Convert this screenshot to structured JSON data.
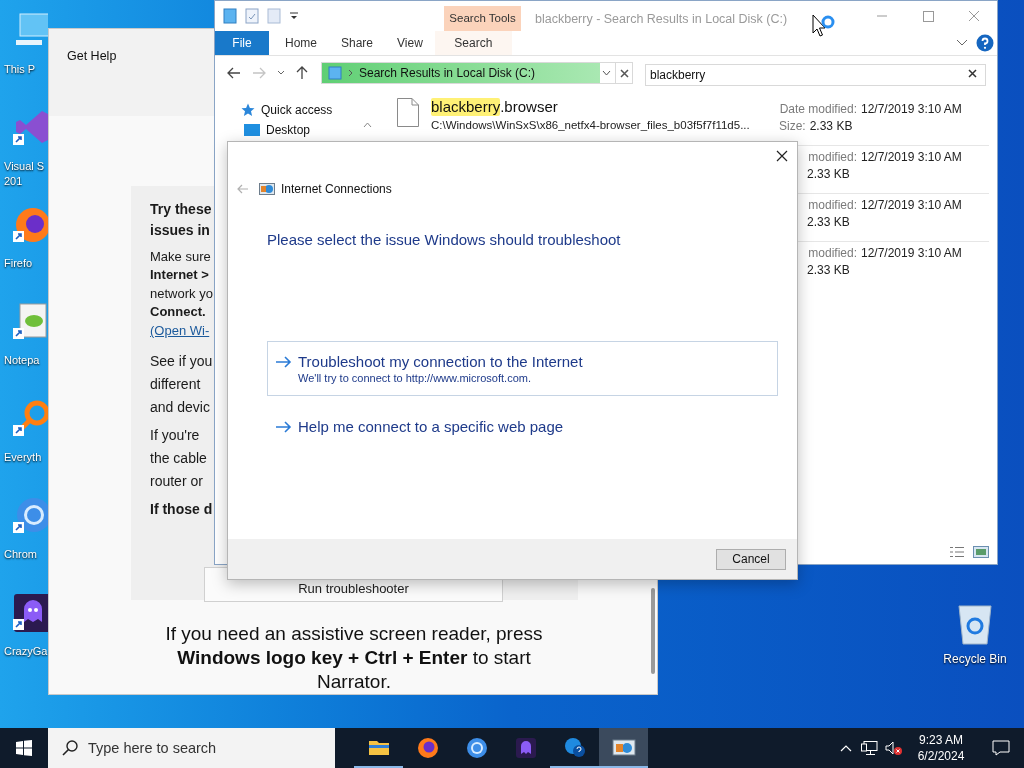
{
  "desktop": {
    "icons": [
      {
        "kind": "computer",
        "lines": [
          "This P"
        ]
      },
      {
        "kind": "studio",
        "lines": [
          "Visual S",
          "201"
        ]
      },
      {
        "kind": "firefox",
        "lines": [
          "Firefo"
        ]
      },
      {
        "kind": "notepad",
        "lines": [
          "Notepa"
        ]
      },
      {
        "kind": "everything",
        "lines": [
          "Everyth"
        ]
      },
      {
        "kind": "chrome",
        "lines": [
          "Chrom"
        ]
      },
      {
        "kind": "crazygames",
        "lines": [
          "CrazyGa"
        ]
      }
    ],
    "recycle_bin": {
      "label": "Recycle Bin"
    }
  },
  "get_help": {
    "title": "Get Help",
    "paragraphs": [
      {
        "kind": "heading",
        "lines": [
          {
            "text": "Try these",
            "kind": "text",
            "bold": true
          },
          {
            "text": "issues in",
            "kind": "text",
            "bold": true
          }
        ]
      },
      {
        "kind": "small",
        "lines": [
          {
            "text": "Make sure",
            "kind": "text",
            "bold": false
          },
          {
            "text": "Internet >",
            "kind": "text",
            "bold": true
          },
          {
            "text": "network yo",
            "kind": "text",
            "bold": false
          },
          {
            "text": "Connect.",
            "kind": "text",
            "bold": true
          },
          {
            "text": "(Open Wi-",
            "kind": "link",
            "bold": false
          }
        ]
      },
      {
        "kind": "body",
        "lines": [
          {
            "text": "See if you",
            "kind": "text",
            "bold": false
          },
          {
            "text": "different",
            "kind": "text",
            "bold": false
          },
          {
            "text": "and devic",
            "kind": "text",
            "bold": false
          }
        ]
      },
      {
        "kind": "body",
        "lines": [
          {
            "text": "If you're",
            "kind": "text",
            "bold": false
          },
          {
            "text": "the cable",
            "kind": "text",
            "bold": false
          },
          {
            "text": "router or",
            "kind": "text",
            "bold": false
          }
        ]
      },
      {
        "kind": "body",
        "lines": [
          {
            "text": "If those d",
            "kind": "text",
            "bold": true
          }
        ]
      }
    ],
    "run_button": "Run troubleshooter",
    "narrator": "If you need an assistive screen reader, press **Windows logo key + Ctrl + Enter** to start Narrator."
  },
  "explorer": {
    "title": "blackberry - Search Results in Local Disk (C:)",
    "context_tab": "Search Tools",
    "tabs": [
      {
        "label": "File",
        "kind": "file"
      },
      {
        "label": "Home",
        "kind": "tab"
      },
      {
        "label": "Share",
        "kind": "tab"
      },
      {
        "label": "View",
        "kind": "tab"
      },
      {
        "label": "Search",
        "kind": "contextual"
      }
    ],
    "address": {
      "text": "Search Results in Local Disk (C:)",
      "level": 0.95
    },
    "search": {
      "value": "blackberry"
    },
    "nav": [
      {
        "label": "Quick access",
        "kind": "quick"
      },
      {
        "label": "Desktop",
        "kind": "folder"
      }
    ],
    "results": [
      {
        "match": "blackberry",
        "rest": ".browser",
        "path": "C:\\Windows\\WinSxS\\x86_netfx4-browser_files_b03f5f7f11d5...",
        "date_label": "Date modified:",
        "date": "12/7/2019 3:10 AM",
        "size_label": "Size:",
        "size": "2.33 KB"
      },
      {
        "date_label": "modified:",
        "date": "12/7/2019 3:10 AM",
        "size": "2.33 KB"
      },
      {
        "date_label": "modified:",
        "date": "12/7/2019 3:10 AM",
        "size": "2.33 KB"
      },
      {
        "date_label": "modified:",
        "date": "12/7/2019 3:10 AM",
        "size": "2.33 KB"
      }
    ]
  },
  "dialog": {
    "title": "Internet Connections",
    "heading": "Please select the issue Windows should troubleshoot",
    "options": [
      {
        "title": "Troubleshoot my connection to the Internet",
        "subtitle": "We'll try to connect to http://www.microsoft.com.",
        "selected": true
      },
      {
        "title": "Help me connect to a specific web page",
        "selected": false
      }
    ],
    "cancel": "Cancel"
  },
  "taskbar": {
    "search": {
      "placeholder": "Type here to search"
    },
    "apps": [
      {
        "kind": "explorer",
        "running": true,
        "selected": false
      },
      {
        "kind": "firefox",
        "running": false,
        "selected": false
      },
      {
        "kind": "chrome",
        "running": false,
        "selected": false
      },
      {
        "kind": "crazygames",
        "running": false,
        "selected": false
      },
      {
        "kind": "gethelp",
        "running": true,
        "selected": false
      },
      {
        "kind": "network",
        "running": true,
        "selected": true
      }
    ],
    "time": "9:23 AM",
    "date": "6/2/2024"
  }
}
